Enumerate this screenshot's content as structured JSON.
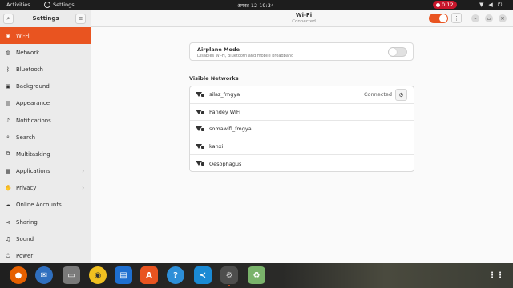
{
  "topbar": {
    "activities": "Activities",
    "app_name": "Settings",
    "clock": "अगस्त 12  19:34",
    "recording": "0:12"
  },
  "sidebar": {
    "title": "Settings",
    "items": [
      {
        "label": "Wi-Fi",
        "icon": "wifi-icon",
        "active": true
      },
      {
        "label": "Network",
        "icon": "network-icon"
      },
      {
        "label": "Bluetooth",
        "icon": "bluetooth-icon"
      },
      {
        "label": "Background",
        "icon": "background-icon"
      },
      {
        "label": "Appearance",
        "icon": "appearance-icon"
      },
      {
        "label": "Notifications",
        "icon": "bell-icon"
      },
      {
        "label": "Search",
        "icon": "search-icon"
      },
      {
        "label": "Multitasking",
        "icon": "multitasking-icon"
      },
      {
        "label": "Applications",
        "icon": "grid-icon",
        "chevron": true
      },
      {
        "label": "Privacy",
        "icon": "hand-icon",
        "chevron": true
      },
      {
        "label": "Online Accounts",
        "icon": "cloud-icon"
      },
      {
        "label": "Sharing",
        "icon": "share-icon"
      },
      {
        "label": "Sound",
        "icon": "music-icon"
      },
      {
        "label": "Power",
        "icon": "power-icon"
      }
    ]
  },
  "header": {
    "title": "Wi-Fi",
    "subtitle": "Connected",
    "wifi_enabled": true
  },
  "airplane": {
    "title": "Airplane Mode",
    "subtitle": "Disables Wi-Fi, Bluetooth and mobile broadband",
    "enabled": false
  },
  "networks": {
    "label": "Visible Networks",
    "items": [
      {
        "name": "silaz_fmgya",
        "status": "Connected"
      },
      {
        "name": "Pandey WiFi",
        "status": ""
      },
      {
        "name": "somawifi_fmgya",
        "status": ""
      },
      {
        "name": "kanxi",
        "status": ""
      },
      {
        "name": "Oesophagus",
        "status": ""
      }
    ]
  },
  "dock": [
    {
      "name": "firefox",
      "color": "#e66000"
    },
    {
      "name": "thunderbird",
      "color": "#2f6fbf"
    },
    {
      "name": "files",
      "color": "#7a7a7a"
    },
    {
      "name": "rhythmbox",
      "color": "#f0c020"
    },
    {
      "name": "writer",
      "color": "#1e6fd0"
    },
    {
      "name": "software",
      "color": "#e95420"
    },
    {
      "name": "help",
      "color": "#2d8fd8"
    },
    {
      "name": "vscode",
      "color": "#1a8ad4"
    },
    {
      "name": "settings",
      "color": "#8a8a8a"
    },
    {
      "name": "trash",
      "color": "#7ab36b"
    }
  ]
}
